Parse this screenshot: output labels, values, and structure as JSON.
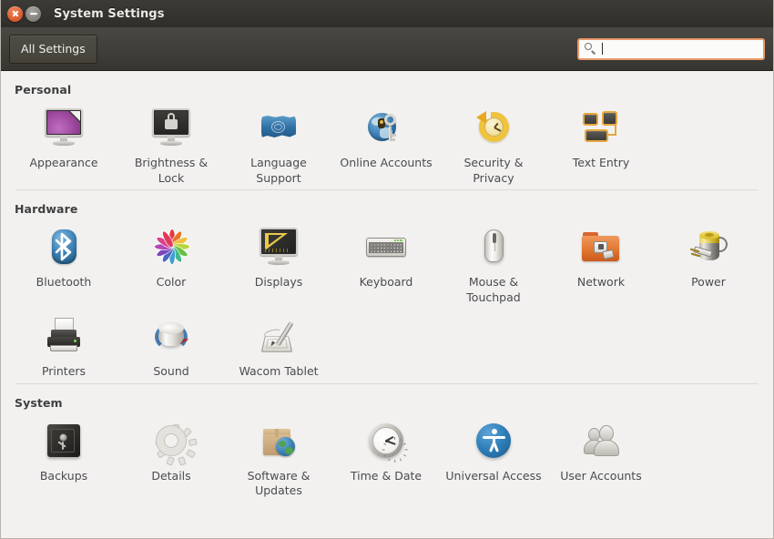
{
  "window": {
    "title": "System Settings",
    "close_icon": "close-icon",
    "minimize_icon": "minimize-icon"
  },
  "toolbar": {
    "all_settings_label": "All Settings",
    "search_icon": "search-icon",
    "search_value": "",
    "search_placeholder": ""
  },
  "sections": [
    {
      "id": "personal",
      "title": "Personal",
      "items": [
        {
          "label": "Appearance",
          "icon": "appearance-icon"
        },
        {
          "label": "Brightness & Lock",
          "icon": "brightness-lock-icon"
        },
        {
          "label": "Language Support",
          "icon": "language-support-icon"
        },
        {
          "label": "Online Accounts",
          "icon": "online-accounts-icon"
        },
        {
          "label": "Security & Privacy",
          "icon": "security-privacy-icon"
        },
        {
          "label": "Text Entry",
          "icon": "text-entry-icon"
        }
      ]
    },
    {
      "id": "hardware",
      "title": "Hardware",
      "items": [
        {
          "label": "Bluetooth",
          "icon": "bluetooth-icon"
        },
        {
          "label": "Color",
          "icon": "color-icon"
        },
        {
          "label": "Displays",
          "icon": "displays-icon"
        },
        {
          "label": "Keyboard",
          "icon": "keyboard-icon"
        },
        {
          "label": "Mouse & Touchpad",
          "icon": "mouse-touchpad-icon"
        },
        {
          "label": "Network",
          "icon": "network-icon"
        },
        {
          "label": "Power",
          "icon": "power-icon"
        },
        {
          "label": "Printers",
          "icon": "printers-icon"
        },
        {
          "label": "Sound",
          "icon": "sound-icon"
        },
        {
          "label": "Wacom Tablet",
          "icon": "wacom-tablet-icon"
        }
      ]
    },
    {
      "id": "system",
      "title": "System",
      "items": [
        {
          "label": "Backups",
          "icon": "backups-icon"
        },
        {
          "label": "Details",
          "icon": "details-icon"
        },
        {
          "label": "Software & Updates",
          "icon": "software-updates-icon"
        },
        {
          "label": "Time & Date",
          "icon": "time-date-icon"
        },
        {
          "label": "Universal Access",
          "icon": "universal-access-icon"
        },
        {
          "label": "User Accounts",
          "icon": "user-accounts-icon"
        }
      ]
    }
  ],
  "colors": {
    "titlebar": "#35342f",
    "toolbar": "#403e39",
    "content_bg": "#f2f1f0",
    "accent_orange": "#e8996a",
    "label_text": "#4b4b50",
    "heading_text": "#3f3f3f"
  }
}
